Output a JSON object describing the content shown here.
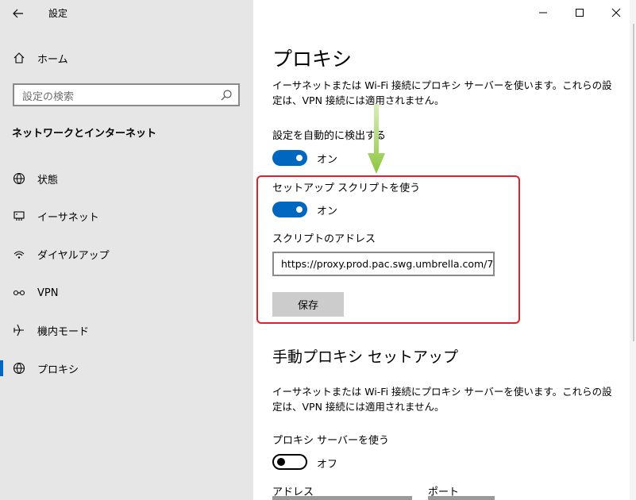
{
  "window": {
    "title": "設定",
    "controls": [
      "minimize-icon",
      "maximize-icon",
      "close-icon"
    ]
  },
  "sidebar": {
    "home_label": "ホーム",
    "search_placeholder": "設定の検索",
    "section_title": "ネットワークとインターネット",
    "items": [
      {
        "label": "状態",
        "icon": "globe-status-icon"
      },
      {
        "label": "イーサネット",
        "icon": "ethernet-icon"
      },
      {
        "label": "ダイヤルアップ",
        "icon": "dialup-icon"
      },
      {
        "label": "VPN",
        "icon": "vpn-icon"
      },
      {
        "label": "機内モード",
        "icon": "airplane-icon"
      },
      {
        "label": "プロキシ",
        "icon": "globe-icon",
        "active": true
      }
    ]
  },
  "main": {
    "title": "プロキシ",
    "description": "イーサネットまたは Wi-Fi 接続にプロキシ サーバーを使います。これらの設定は、VPN 接続には適用されません。",
    "auto_detect": {
      "label": "設定を自動的に検出する",
      "state": "オン"
    },
    "setup_script": {
      "label": "セットアップ スクリプトを使う",
      "state": "オン"
    },
    "script_address": {
      "label": "スクリプトのアドレス",
      "value": "https://proxy.prod.pac.swg.umbrella.com/7"
    },
    "save_label": "保存",
    "manual_title": "手動プロキシ セットアップ",
    "manual_description": "イーサネットまたは Wi-Fi 接続にプロキシ サーバーを使います。これらの設定は、VPN 接続には適用されません。",
    "use_proxy": {
      "label": "プロキシ サーバーを使う",
      "state": "オフ"
    },
    "address_label": "アドレス",
    "port_label": "ポート"
  },
  "colors": {
    "accent": "#0067c0",
    "highlight": "#e2202a",
    "arrow": "#8cc63f",
    "sidebar_bg": "#e6e6e6"
  }
}
